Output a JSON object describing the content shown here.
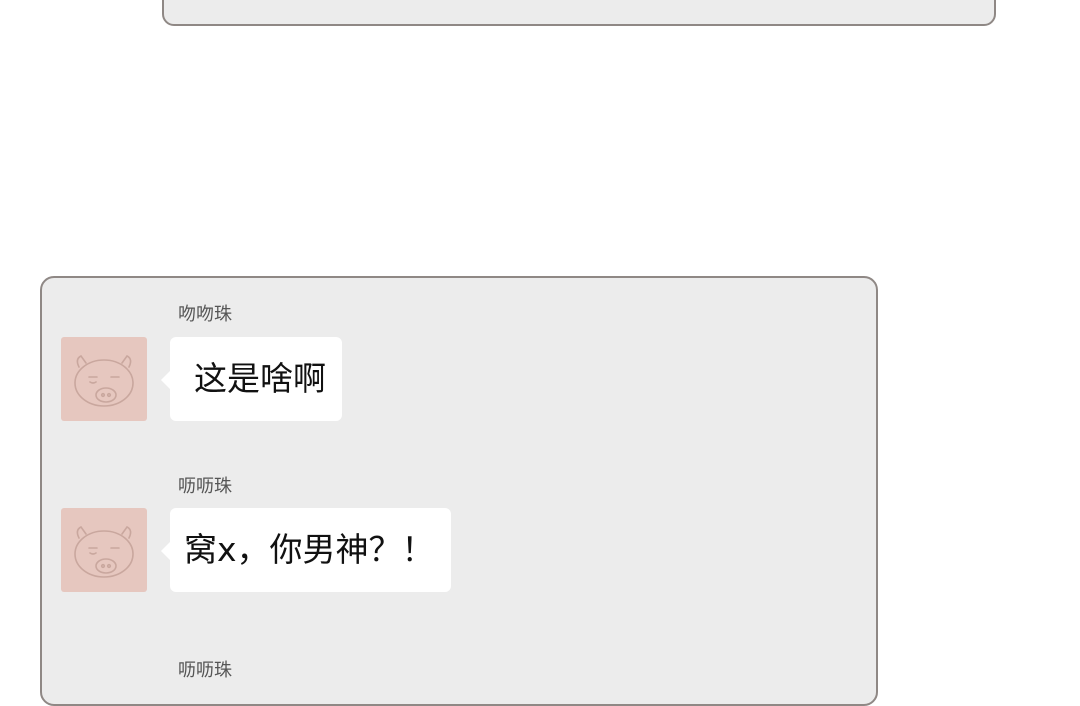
{
  "messages": [
    {
      "sender": "吻吻珠",
      "text": "这是啥啊",
      "avatar": "pig-face-icon"
    },
    {
      "sender": "呖呖珠",
      "text": "窝x，你男神？！",
      "avatar": "pig-face-icon"
    },
    {
      "sender": "呖呖珠"
    }
  ],
  "colors": {
    "panel_bg": "#ececec",
    "panel_border": "#8f8885",
    "avatar_bg": "#e6c7bf",
    "bubble_bg": "#ffffff"
  }
}
